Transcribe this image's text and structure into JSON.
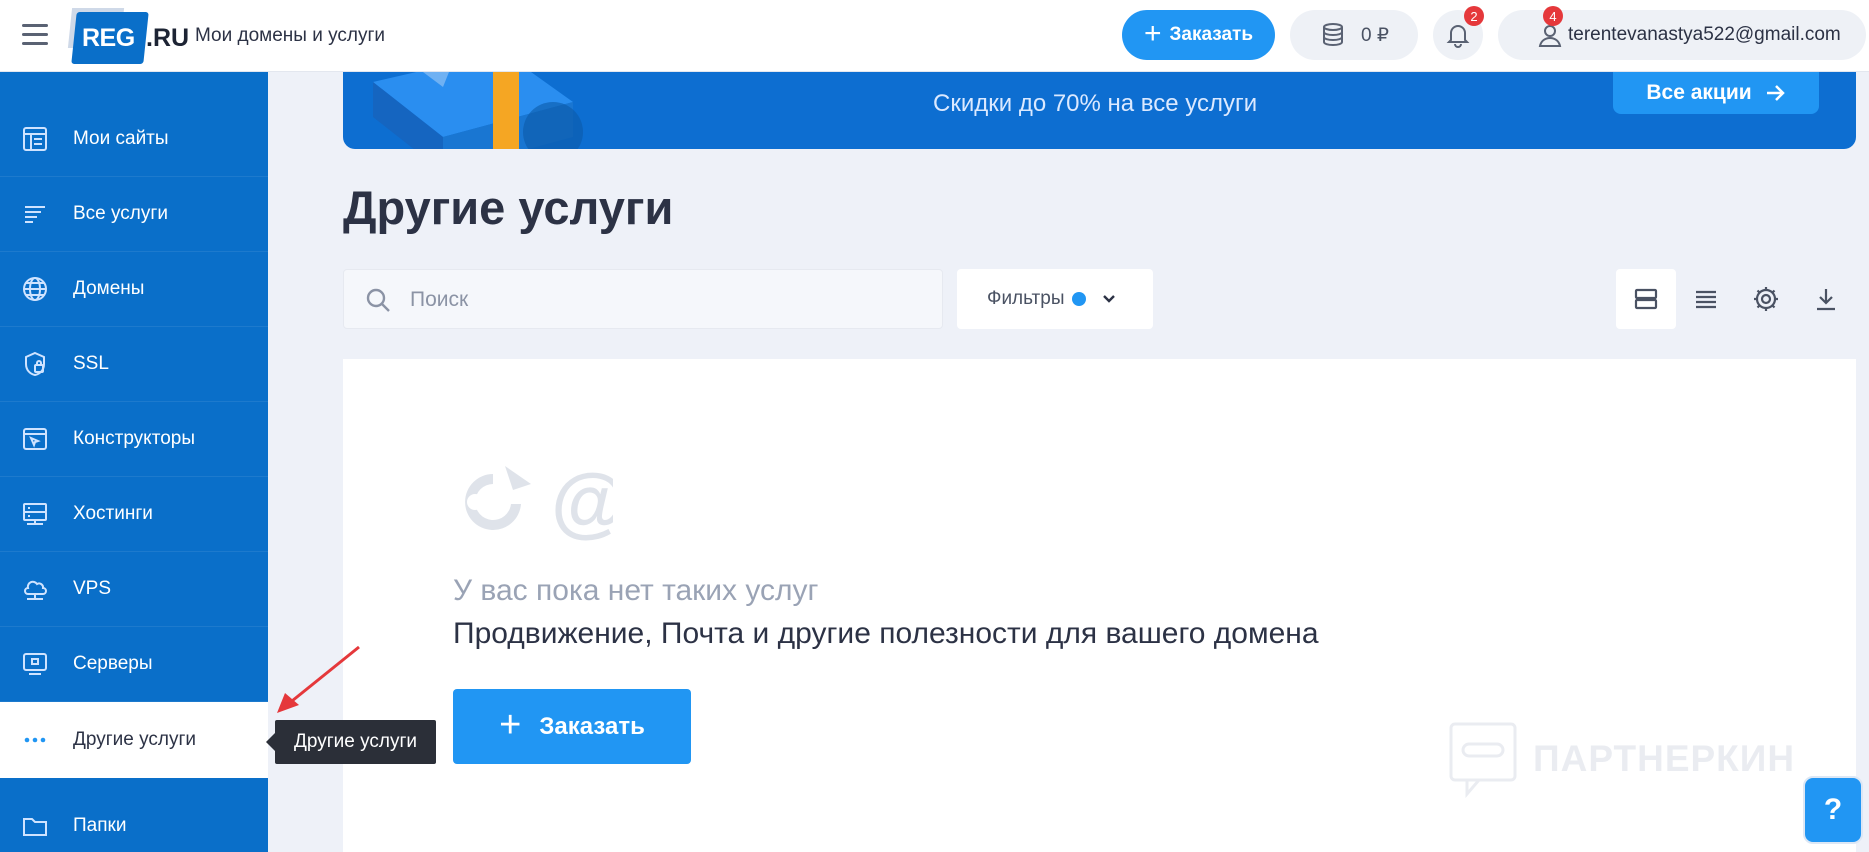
{
  "header": {
    "logo_text_reg": "REG",
    "logo_text_ru": ".RU",
    "subtitle": "Мои домены и услуги",
    "order_label": "Заказать",
    "balance": "0 ₽",
    "notifications_count": "2",
    "user_badge_count": "4",
    "user_email": "terentevanastya522@gmail.com"
  },
  "sidebar": {
    "items": [
      {
        "label": "Мои сайты",
        "icon": "sites-icon"
      },
      {
        "label": "Все услуги",
        "icon": "list-icon"
      },
      {
        "label": "Домены",
        "icon": "globe-icon"
      },
      {
        "label": "SSL",
        "icon": "shield-lock-icon"
      },
      {
        "label": "Конструкторы",
        "icon": "builder-icon"
      },
      {
        "label": "Хостинги",
        "icon": "hosting-icon"
      },
      {
        "label": "VPS",
        "icon": "vps-icon"
      },
      {
        "label": "Серверы",
        "icon": "server-icon"
      },
      {
        "label": "Другие услуги",
        "icon": "more-dots-icon"
      },
      {
        "label": "Папки",
        "icon": "folder-icon"
      }
    ],
    "active_index": 8
  },
  "banner": {
    "subtitle": "Скидки до 70% на все услуги",
    "button_label": "Все акции"
  },
  "main": {
    "title": "Другие услуги",
    "search_placeholder": "Поиск",
    "filters_label": "Фильтры",
    "empty_title": "У вас пока нет таких услуг",
    "empty_desc": "Продвижение, Почта и другие полезности для вашего домена",
    "order_button": "Заказать"
  },
  "tooltip": "Другие услуги",
  "watermark": "ПАРТНЕРКИН",
  "help_label": "?",
  "colors": {
    "sidebar": "#0a6fc9",
    "accent": "#2196f3",
    "badge": "#e5383b"
  }
}
